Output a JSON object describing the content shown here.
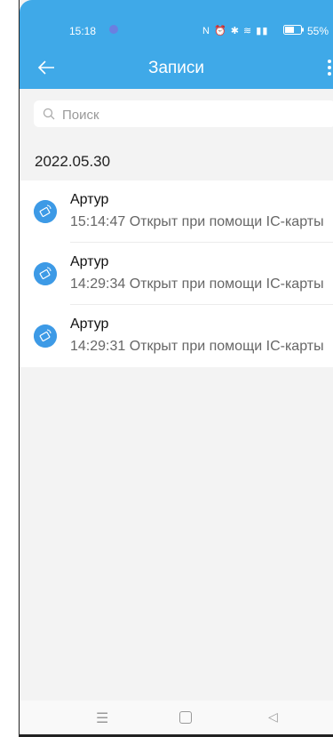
{
  "status_bar": {
    "time": "15:18",
    "icons": "N ⏰ ✱ ≋ ▮▮",
    "battery": "55%"
  },
  "appbar": {
    "title": "Записи",
    "back_icon": "arrow-left-icon",
    "more_icon": "more-vertical-icon"
  },
  "search": {
    "placeholder": "Поиск",
    "value": ""
  },
  "date_group": "2022.05.30",
  "records": [
    {
      "name": "Артур",
      "detail": "15:14:47 Открыт при помощи IC-карты"
    },
    {
      "name": "Артур",
      "detail": "14:29:34 Открыт при помощи IC-карты"
    },
    {
      "name": "Артур",
      "detail": "14:29:31 Открыт при помощи IC-карты"
    }
  ],
  "navbar": {
    "menu_glyph": "☰",
    "back_glyph": "◁"
  },
  "colors": {
    "accent": "#3fa9e8",
    "icon_blue": "#3d9ae6",
    "background": "#f3f3f3"
  }
}
